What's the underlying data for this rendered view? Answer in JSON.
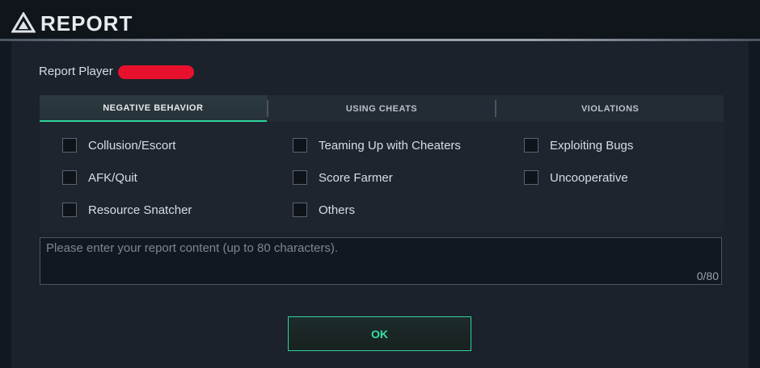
{
  "header": {
    "title": "REPORT",
    "logo_icon": "triangle-logo-icon"
  },
  "report": {
    "label": "Report Player"
  },
  "tabs": [
    {
      "label": "NEGATIVE BEHAVIOR",
      "active": true
    },
    {
      "label": "USING CHEATS",
      "active": false
    },
    {
      "label": "VIOLATIONS",
      "active": false
    }
  ],
  "reasons": [
    {
      "label": "Collusion/Escort",
      "checked": false
    },
    {
      "label": "AFK/Quit",
      "checked": false
    },
    {
      "label": "Resource Snatcher",
      "checked": false
    },
    {
      "label": "Teaming Up with Cheaters",
      "checked": false
    },
    {
      "label": "Score Farmer",
      "checked": false
    },
    {
      "label": "Others",
      "checked": false
    },
    {
      "label": "Exploiting Bugs",
      "checked": false
    },
    {
      "label": "Uncooperative",
      "checked": false
    }
  ],
  "content": {
    "placeholder": "Please enter your report content (up to 80 characters).",
    "value": "",
    "counter": "0/80"
  },
  "actions": {
    "ok_label": "OK"
  },
  "colors": {
    "accent": "#2fd39a",
    "redaction": "#e8112d"
  }
}
